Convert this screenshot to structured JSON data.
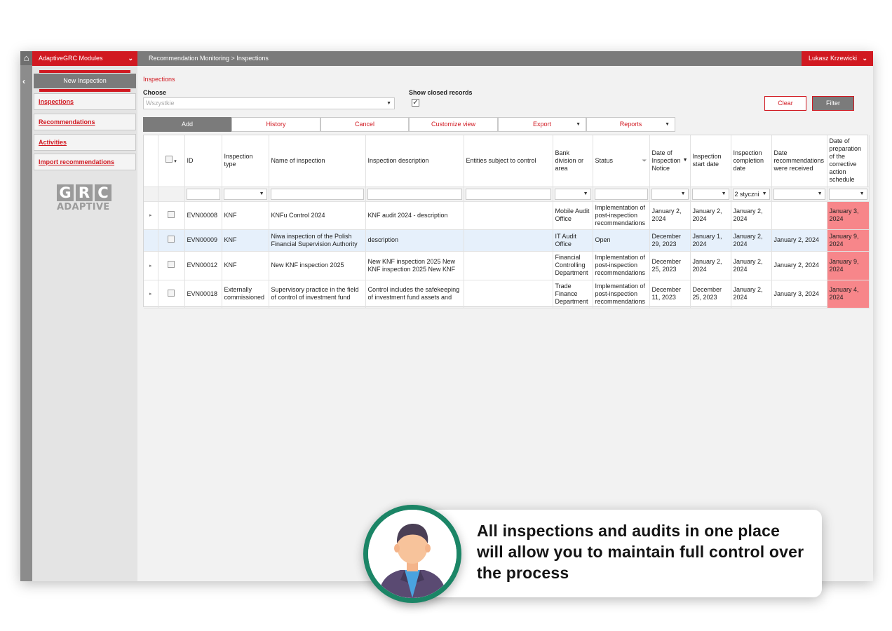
{
  "sidebar": {
    "modules_label": "AdaptiveGRC Modules",
    "new_inspection_label": "New Inspection",
    "items": [
      {
        "label": "Inspections"
      },
      {
        "label": "Recommendations"
      },
      {
        "label": "Activities"
      },
      {
        "label": "Import recommendations"
      }
    ],
    "logo_letters": [
      "G",
      "R",
      "C"
    ],
    "logo_word": "ADAPTIVE"
  },
  "header": {
    "breadcrumb": "Recommendation Monitoring > Inspections",
    "user_name": "Lukasz Krzewicki"
  },
  "filters": {
    "section_title": "Inspections",
    "choose_label": "Choose",
    "choose_value": "Wszystkie",
    "show_closed_label": "Show closed records",
    "show_closed_checked": true,
    "clear_label": "Clear",
    "filter_label": "Filter"
  },
  "toolbar": {
    "add_label": "Add",
    "history_label": "History",
    "cancel_label": "Cancel",
    "customize_label": "Customize view",
    "export_label": "Export",
    "reports_label": "Reports"
  },
  "table": {
    "columns": {
      "id": "ID",
      "type": "Inspection type",
      "name": "Name of inspection",
      "description": "Inspection description",
      "entities": "Entities subject to control",
      "bank_division": "Bank division or area",
      "status": "Status",
      "notice_date": "Date of Inspection Notice",
      "start_date": "Inspection start date",
      "completion_date": "Inspection completion date",
      "received_date": "Date recommendations were received",
      "schedule_date": "Date of preparation of the corrective action schedule"
    },
    "completion_filter_value": "2 styczni",
    "rows": [
      {
        "id": "EVN00008",
        "type": "KNF",
        "name": "KNFu Control 2024",
        "description": "KNF audit 2024 - description",
        "entities": "",
        "bank_division": "Mobile Audit Office",
        "status": "Implementation of post-inspection recommendations",
        "notice_date": "January 2, 2024",
        "start_date": "January 2, 2024",
        "completion_date": "January 2, 2024",
        "received_date": "",
        "schedule_date": "January 3, 2024"
      },
      {
        "id": "EVN00009",
        "type": "KNF",
        "name": "Niwa inspection of the Polish Financial Supervision Authority",
        "description": "description",
        "entities": "",
        "bank_division": "IT Audit Office",
        "status": "Open",
        "notice_date": "December 29, 2023",
        "start_date": "January 1, 2024",
        "completion_date": "January 2, 2024",
        "received_date": "January 2, 2024",
        "schedule_date": "January 9, 2024"
      },
      {
        "id": "EVN00012",
        "type": "KNF",
        "name": "New KNF inspection 2025",
        "description": "New KNF inspection 2025 New KNF inspection 2025 New KNF",
        "entities": "",
        "bank_division": "Financial Controlling Department",
        "status": "Implementation of post-inspection recommendations",
        "notice_date": "December 25, 2023",
        "start_date": "January 2, 2024",
        "completion_date": "January 2, 2024",
        "received_date": "January 2, 2024",
        "schedule_date": "January 9, 2024"
      },
      {
        "id": "EVN00018",
        "type": "Externally commissioned",
        "name": "Supervisory practice in the field of control of investment fund",
        "description": "Control includes the safekeeping of investment fund assets and",
        "entities": "",
        "bank_division": "Trade Finance Department",
        "status": "Implementation of post-inspection recommendations",
        "notice_date": "December 11, 2023",
        "start_date": "December 25, 2023",
        "completion_date": "January 2, 2024",
        "received_date": "January 3, 2024",
        "schedule_date": "January 4, 2024"
      }
    ]
  },
  "callout": {
    "text": "All inspections and audits in one place will allow you to maintain full control over the process"
  },
  "colors": {
    "brand_red": "#d11921",
    "toolbar_gray": "#7b7b7b",
    "overdue_pink": "#f7868a",
    "avatar_ring_green": "#1b8566"
  }
}
